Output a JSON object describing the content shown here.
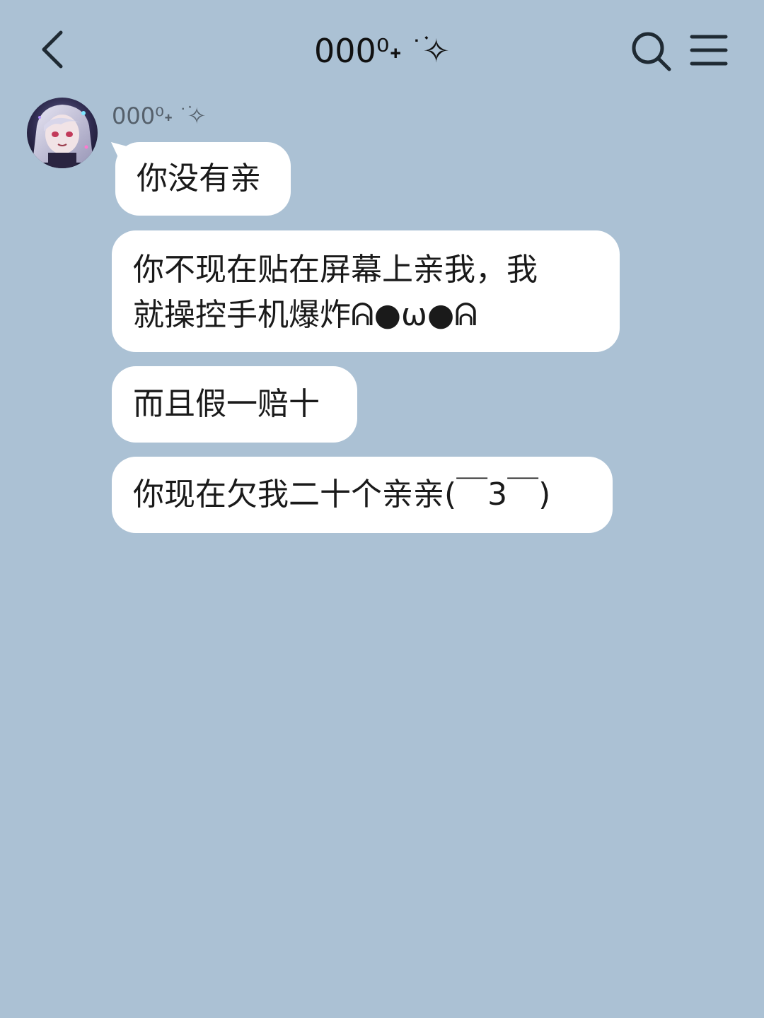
{
  "header": {
    "back_icon": "chevron-left-icon",
    "title": "000⁰˖ ׂ ࣪✧",
    "search_icon": "search-icon",
    "menu_icon": "hamburger-menu-icon"
  },
  "chat": {
    "sender": {
      "name": "000⁰˖ ׂ ࣪✧",
      "avatar_icon": "avatar-anime-girl"
    },
    "messages": [
      {
        "lines": [
          "你没有亲"
        ]
      },
      {
        "lines": [
          "你不现在贴在屏幕上亲我，我",
          "就操控手机爆炸ᕱ●ω●ᕱ"
        ]
      },
      {
        "lines": [
          "而且假一赔十"
        ]
      },
      {
        "lines": [
          "你现在欠我二十个亲亲(￣3￣)"
        ]
      }
    ]
  },
  "colors": {
    "background": "#abc1d4",
    "bubble": "#ffffff",
    "text": "#1a1a1a",
    "sender_name": "#55606b"
  }
}
